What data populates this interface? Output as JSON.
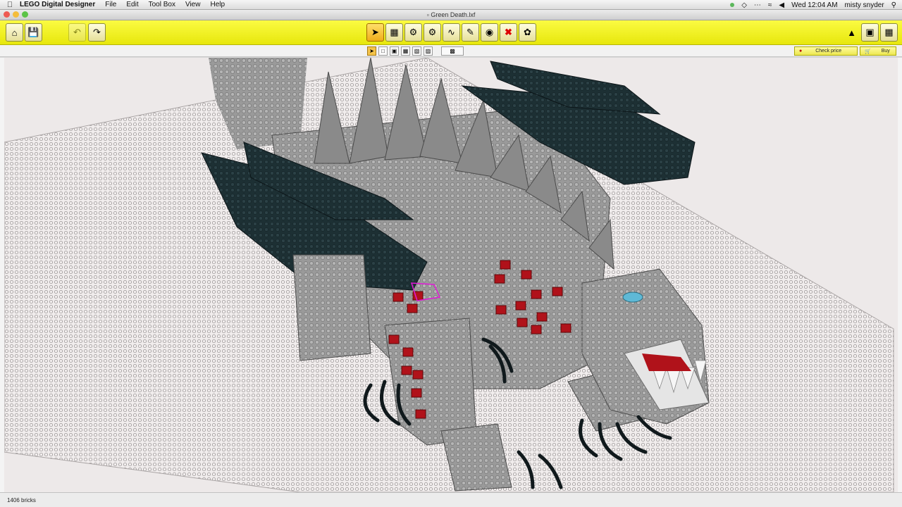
{
  "menubar": {
    "app_name": "LEGO Digital Designer",
    "items": [
      "File",
      "Edit",
      "Tool Box",
      "View",
      "Help"
    ],
    "clock": "Wed 12:04 AM",
    "user": "misty snyder"
  },
  "window": {
    "title": "Green Death.lxf"
  },
  "toolbar": {
    "left_buttons": [
      "home-icon",
      "save-icon",
      "undo-icon",
      "redo-icon"
    ],
    "tool_buttons": [
      "select-arrow-icon",
      "clone-icon",
      "hinge-icon",
      "hinge-align-icon",
      "flex-icon",
      "paint-icon",
      "hide-icon",
      "delete-icon",
      "decorate-icon"
    ],
    "mode_buttons": [
      "build-mode-icon",
      "view-mode-icon",
      "instructions-icon"
    ],
    "check_price_label": "Check price",
    "buy_label": "Buy"
  },
  "status": {
    "brick_count": "1406 bricks"
  },
  "colors": {
    "toolbar": "#efef1e",
    "accent": "#f0ad1a",
    "brick_red": "#b0121a",
    "brick_dark": "#1d2f33"
  }
}
